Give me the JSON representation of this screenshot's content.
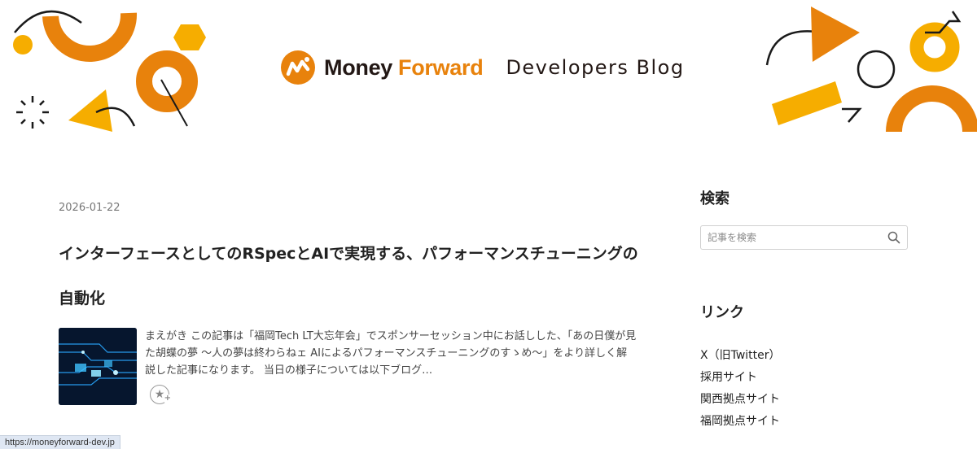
{
  "header": {
    "logo_money": "Money",
    "logo_forward": "Forward",
    "logo_blog": "Developers Blog",
    "colors": {
      "orange": "#e8820c",
      "yellow": "#f6ad00",
      "dark": "#231815"
    }
  },
  "article": {
    "date": "2026-01-22",
    "title": "インターフェースとしてのRSpecとAIで実現する、パフォーマンスチューニングの自動化",
    "summary": "まえがき この記事は「福岡Tech LT大忘年会」でスポンサーセッション中にお話しした、「あの日僕が見た胡蝶の夢 〜人の夢は終わらねェ AIによるパフォーマンスチューニングのすゝめ〜」をより詳しく解説した記事になります。 当日の様子については以下ブログ…",
    "thumbnail_icon": "circuit-image",
    "star_icon": "add-star-icon"
  },
  "sidebar": {
    "search_title": "検索",
    "search_placeholder": "記事を検索",
    "links_title": "リンク",
    "links": [
      "X（旧Twitter）",
      "採用サイト",
      "関西拠点サイト",
      "福岡拠点サイト"
    ]
  },
  "status": {
    "url": "https://moneyforward-dev.jp"
  }
}
